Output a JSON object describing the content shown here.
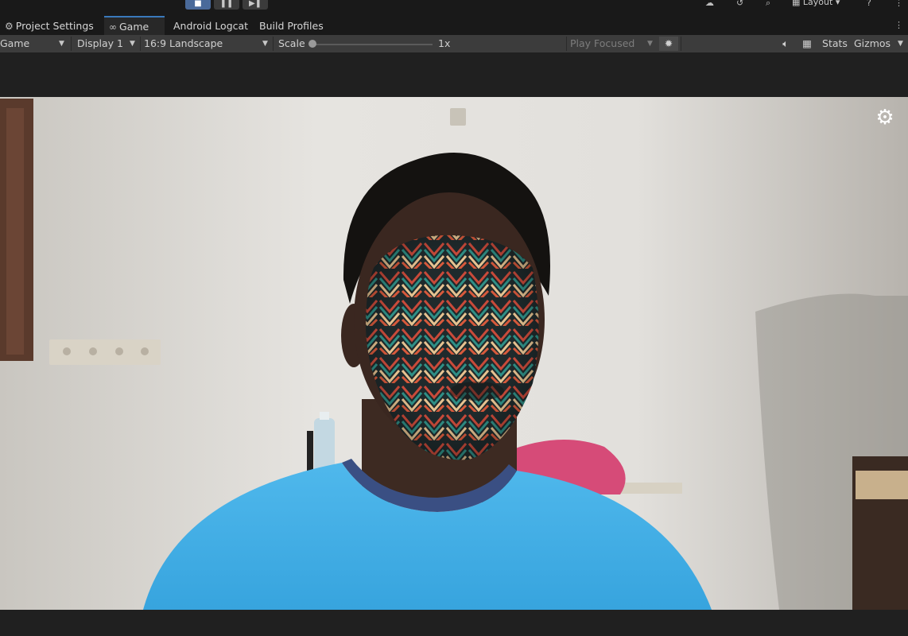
{
  "top_controls": {
    "stop_icon": "stop-icon",
    "pause_icon": "pause-icon",
    "step_icon": "step-icon",
    "layout_label": "Layout"
  },
  "tabs": [
    {
      "label": "Project Settings",
      "icon": "gear-icon"
    },
    {
      "label": "Game",
      "icon": "gamepad-icon"
    },
    {
      "label": "Android Logcat"
    },
    {
      "label": "Build Profiles"
    }
  ],
  "toolbar": {
    "view_select": "Game",
    "display_select": "Display 1",
    "aspect_select": "16:9 Landscape",
    "scale_label": "Scale",
    "scale_value": "1x",
    "scale_level": 0,
    "play_mode_select": "Play Focused",
    "stats_label": "Stats",
    "gizmos_label": "Gizmos"
  },
  "game_view": {
    "settings_icon": "gear-icon"
  },
  "colors": {
    "tab_active_accent": "#3a79bb",
    "toolbar_bg": "#3c3c3c",
    "editor_bg": "#191919"
  }
}
